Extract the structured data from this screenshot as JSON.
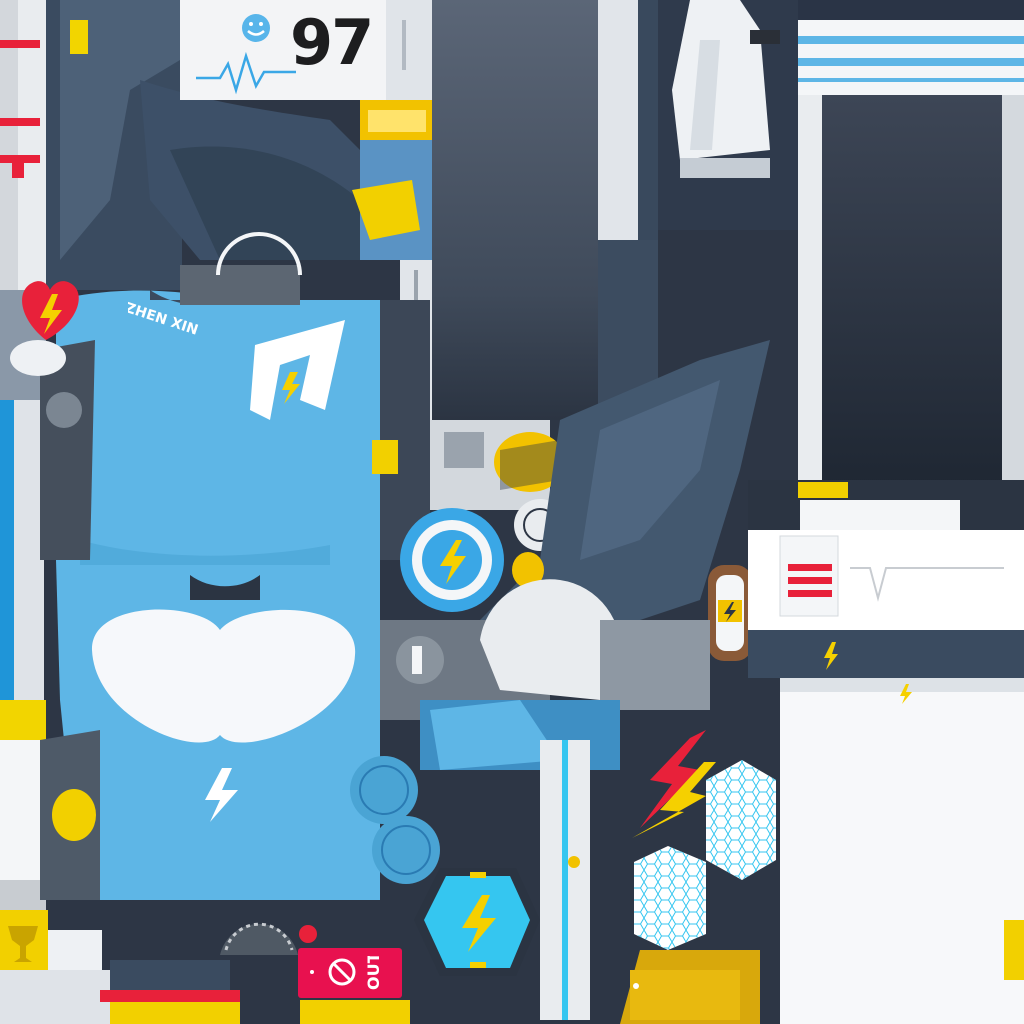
{
  "monitor": {
    "reading": "97"
  },
  "jersey": {
    "player_name": "ZHEN XIN"
  },
  "exit_sign": {
    "label": "OUT"
  },
  "colors": {
    "jersey_blue": "#5eb6e6",
    "dark_slate": "#3a4d63",
    "panel_navy": "#2f3a4c",
    "accent_yellow": "#f5d000",
    "alert_red": "#e8213a",
    "cyan": "#35c6f0",
    "white": "#f4f6f8"
  },
  "icons": [
    "smiley-icon",
    "heartbeat-icon",
    "heart-bolt-icon",
    "lightning-icon",
    "hexagon-bolt-icon",
    "no-entry-icon",
    "gauge-icon",
    "towel-icon",
    "honeycomb-icon"
  ]
}
